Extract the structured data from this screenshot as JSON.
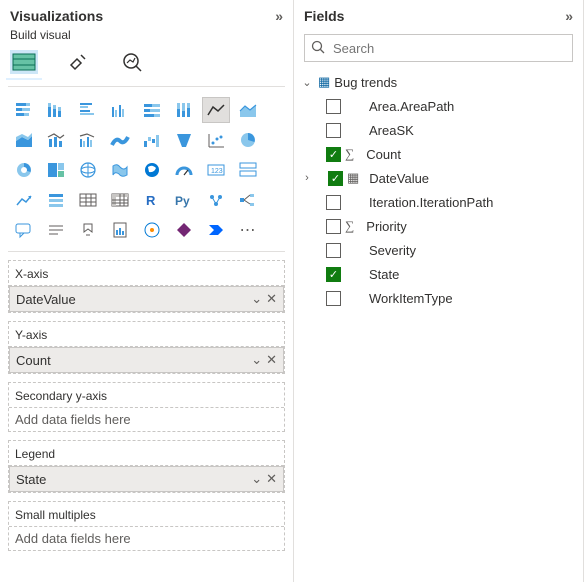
{
  "viz": {
    "title": "Visualizations",
    "sub": "Build visual",
    "wells": {
      "xaxis": {
        "label": "X-axis",
        "value": "DateValue"
      },
      "yaxis": {
        "label": "Y-axis",
        "value": "Count"
      },
      "sec_y": {
        "label": "Secondary y-axis",
        "placeholder": "Add data fields here"
      },
      "legend": {
        "label": "Legend",
        "value": "State"
      },
      "small_mult": {
        "label": "Small multiples",
        "placeholder": "Add data fields here"
      }
    }
  },
  "fields": {
    "title": "Fields",
    "search_placeholder": "Search",
    "table": {
      "name": "Bug trends"
    },
    "items": {
      "area": "Area.AreaPath",
      "areask": "AreaSK",
      "count": "Count",
      "datevalue": "DateValue",
      "iteration": "Iteration.IterationPath",
      "priority": "Priority",
      "severity": "Severity",
      "state": "State",
      "workitemtype": "WorkItemType"
    }
  }
}
